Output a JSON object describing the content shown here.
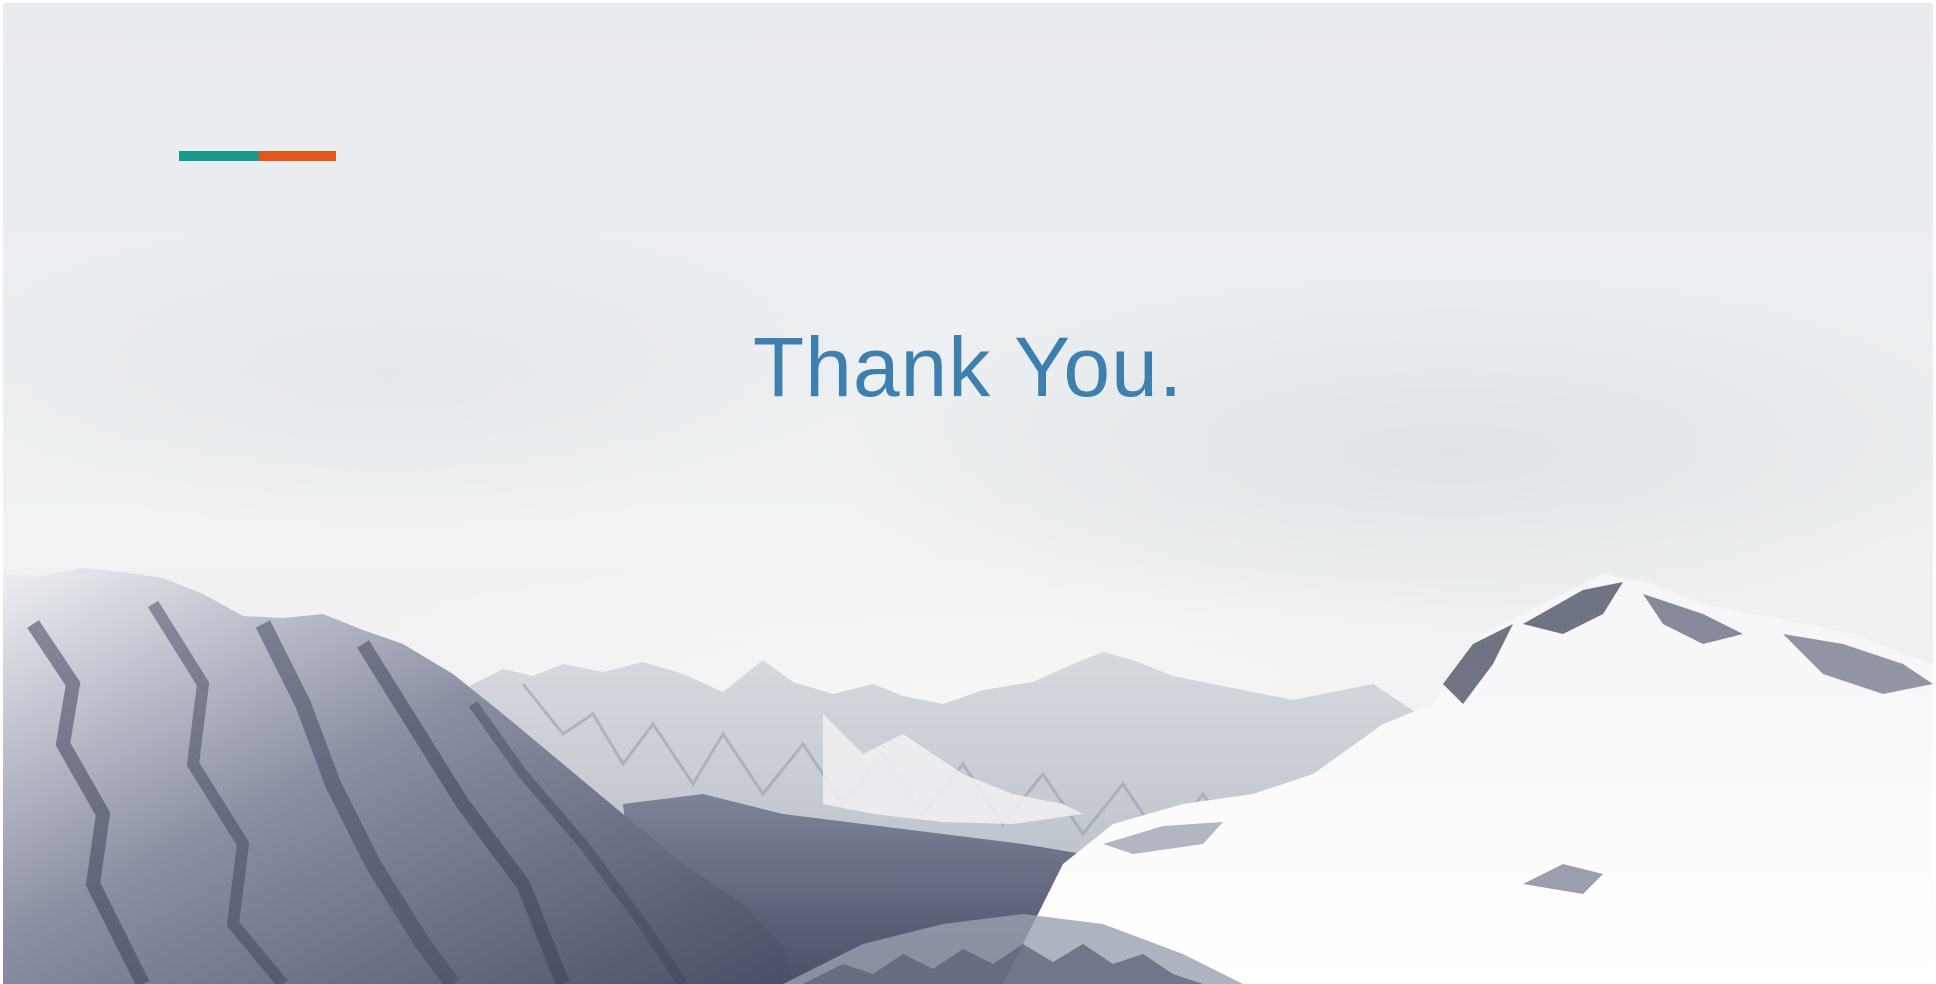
{
  "slide": {
    "title": "Thank You.",
    "accent_colors": {
      "teal": "#1a9a8a",
      "orange": "#e2561a"
    },
    "title_color": "#3e7fae",
    "background_image": "snow-capped-mountains"
  }
}
